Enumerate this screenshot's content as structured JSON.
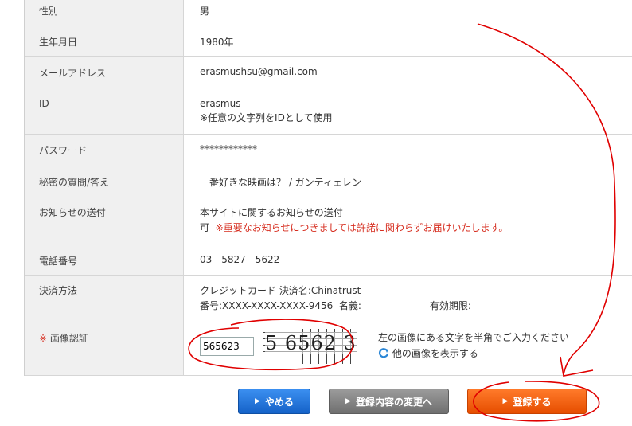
{
  "rows": {
    "gender": {
      "label": "性別",
      "value": "男"
    },
    "birthdate": {
      "label": "生年月日",
      "value": "1980年"
    },
    "email": {
      "label": "メールアドレス",
      "value": "erasmushsu@gmail.com"
    },
    "id": {
      "label": "ID",
      "value": "erasmus",
      "note": "※任意の文字列をIDとして使用"
    },
    "password": {
      "label": "パスワード",
      "value": "************"
    },
    "secret": {
      "label": "秘密の質問/答え",
      "value": "一番好きな映画は？ / ガンティェレン"
    },
    "notice": {
      "label": "お知らせの送付",
      "line1": "本サイトに関するお知らせの送付",
      "line2_prefix": "可",
      "line2_note": "※重要なお知らせにつきましては許諾に関わらずお届けいたします。"
    },
    "phone": {
      "label": "電話番号",
      "value": "03 - 5827 - 5622"
    },
    "payment": {
      "label": "決済方法",
      "line1": "クレジットカード  決済名:Chinatrust",
      "line2_card": "番号:XXXX-XXXX-XXXX-9456",
      "line2_name": "名義:",
      "line2_expiry": "有効期限:"
    },
    "captcha": {
      "label_mark": "※",
      "label": "画像認証",
      "input_value": "565623",
      "image_text": "5 6562 3",
      "instruction": "左の画像にある文字を半角でご入力ください",
      "refresh_link": "他の画像を表示する"
    }
  },
  "buttons": {
    "cancel": "やめる",
    "change": "登録内容の変更へ",
    "register": "登録する"
  },
  "icons": {
    "button_arrow": "▶",
    "refresh": "refresh-icon"
  },
  "colors": {
    "accent_red": "#d62c1e",
    "annotation": "#e00000",
    "cancel_button": "#1562c8",
    "register_button": "#e64e00"
  }
}
